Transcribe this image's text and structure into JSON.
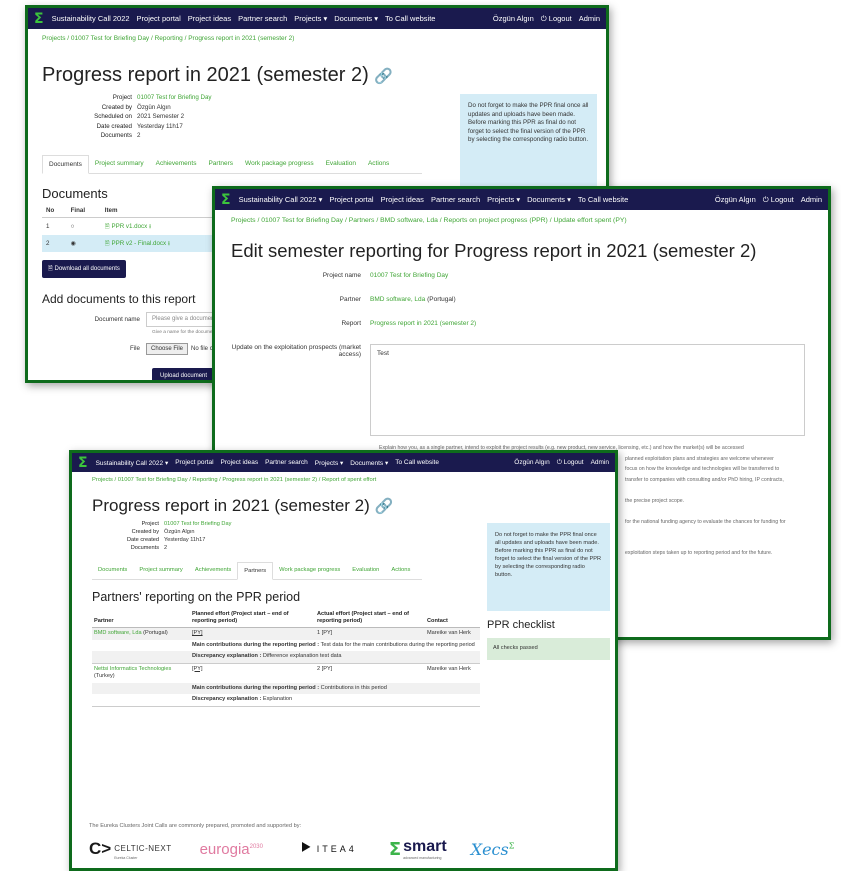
{
  "nav": {
    "logo": "Σ",
    "call_plain": "Sustainability Call 2022",
    "call_dropdown": "Sustainability Call 2022 ▾",
    "project_portal": "Project portal",
    "project_ideas": "Project ideas",
    "partner_search": "Partner search",
    "projects": "Projects ▾",
    "documents": "Documents ▾",
    "to_call_website": "To Call website",
    "user": "Özgün Algın",
    "logout": "⏻ Logout",
    "admin": "Admin"
  },
  "window1": {
    "breadcrumb": "Projects / 01007 Test for Briefing Day / Reporting / Progress report in 2021 (semester 2)",
    "title": "Progress report in 2021 (semester 2)",
    "meta": [
      {
        "label": "Project",
        "value": "01007 Test for Briefing Day"
      },
      {
        "label": "Created by",
        "value": "Özgün Algın"
      },
      {
        "label": "Scheduled on",
        "value": "2021 Semester 2"
      },
      {
        "label": "Date created",
        "value": "Yesterday 11h17"
      },
      {
        "label": "Documents",
        "value": "2"
      }
    ],
    "infobox": "Do not forget to make the PPR final once all updates and uploads have been made. Before marking this PPR as final do not forget to select the final version of the PPR by selecting the corresponding radio button.",
    "tabs": [
      "Documents",
      "Project summary",
      "Achievements",
      "Partners",
      "Work package progress",
      "Evaluation",
      "Actions"
    ],
    "documents_heading": "Documents",
    "doc_columns": [
      "No",
      "Final",
      "Item"
    ],
    "docs": [
      {
        "no": "1",
        "final": "○",
        "item": "PPR v1.docx"
      },
      {
        "no": "2",
        "final": "◉",
        "item": "PPR v2 - Final.docx"
      }
    ],
    "download_all": "Download all documents",
    "add_heading": "Add documents to this report",
    "document_name_label": "Document name",
    "document_name_placeholder": "Please give a document name",
    "document_name_hint": "Give a name for the document",
    "file_label": "File",
    "choose_file": "Choose File",
    "no_file": "No file chosen",
    "upload_button": "Upload document"
  },
  "window2": {
    "breadcrumb": "Projects / 01007 Test for Briefing Day / Partners / BMD software, Lda / Reports on project progress (PPR) / Update effort spent (PY)",
    "title": "Edit semester reporting for Progress report in 2021 (semester 2)",
    "project_name_label": "Project name",
    "project_name_value": "01007 Test for Briefing Day",
    "partner_label": "Partner",
    "partner_link": "BMD software, Lda",
    "partner_country": "(Portugal)",
    "report_label": "Report",
    "report_value": "Progress report in 2021 (semester 2)",
    "update_label": "Update on the exploitation prospects (market access)",
    "update_value": "Test",
    "help_lines": [
      "Explain how you, as a single partner, intend to exploit the project results (e.g. new product, new service, licensing, etc.) and how the market(s) will be accessed",
      "planned exploitation plans and strategies are welcome whenever",
      "focus on how the knowledge and technologies will be transferred to",
      "transfer to companies with consulting and/or PhD hiring, IP contracts,",
      "",
      "the precise project scope.",
      "",
      "for the national funding agency to evaluate the chances for funding for",
      "",
      "",
      "exploitation steps taken up to reporting period and for the future."
    ]
  },
  "window3": {
    "breadcrumb": "Projects / 01007 Test for Briefing Day / Reporting / Progress report in 2021 (semester 2) / Report of spent effort",
    "title": "Progress report in 2021 (semester 2)",
    "meta": [
      {
        "label": "Project",
        "value": "01007 Test for Briefing Day"
      },
      {
        "label": "Created by",
        "value": "Özgün Algın"
      },
      {
        "label": "Date created",
        "value": "Yesterday 11h17"
      },
      {
        "label": "Documents",
        "value": "2"
      }
    ],
    "infobox": "Do not forget to make the PPR final once all updates and uploads have been made. Before marking this PPR as final do not forget to select the final version of the PPR by selecting the corresponding radio button.",
    "tabs": [
      "Documents",
      "Project summary",
      "Achievements",
      "Partners",
      "Work package progress",
      "Evaluation",
      "Actions"
    ],
    "partners_heading": "Partners' reporting on the PPR period",
    "columns": {
      "partner": "Partner",
      "planned": "Planned effort (Project start – end of reporting period)",
      "actual": "Actual effort (Project start – end of reporting period)",
      "contact": "Contact"
    },
    "rows": [
      {
        "partner": "BMD software, Lda",
        "country": "(Portugal)",
        "planned": "[PY]",
        "actual": "1 [PY]",
        "contact": "Mareike van Herk",
        "contrib_label": "Main contributions during the reporting period :",
        "contrib_value": "Test data for the main contributions during the reporting period",
        "disc_label": "Discrepancy explanation :",
        "disc_value": "Difference explanation test data"
      },
      {
        "partner": "Nettsi Informatics Technologies",
        "country": "(Turkey)",
        "planned": "[PY]",
        "actual": "2 [PY]",
        "contact": "Mareike van Herk",
        "contrib_label": "Main contributions during the reporting period :",
        "contrib_value": "Contributions in this period",
        "disc_label": "Discrepancy explanation :",
        "disc_value": "Explanation"
      }
    ],
    "checklist_title": "PPR checklist",
    "checklist_status": "All checks passed",
    "footer_text": "The Eureka Clusters Joint Calls are commonly prepared, promoted and supported by:",
    "logos": {
      "celtic": "CELTIC-NEXT",
      "celtic_sub": "Eureka Cluster",
      "eurogia": "eurogia",
      "eurogia_sup": "2030",
      "itea": "ITEA4",
      "smart": "smart",
      "smart_sub": "advanced manufacturing",
      "xecs": "Xecs",
      "xecs_sup": "Σ"
    }
  },
  "colors": {
    "navbar": "#1a1a4e",
    "link_green": "#3fa535",
    "frame_green": "#0e6b1c",
    "info_blue": "#d4ecf6",
    "check_green": "#d9ecd9"
  }
}
